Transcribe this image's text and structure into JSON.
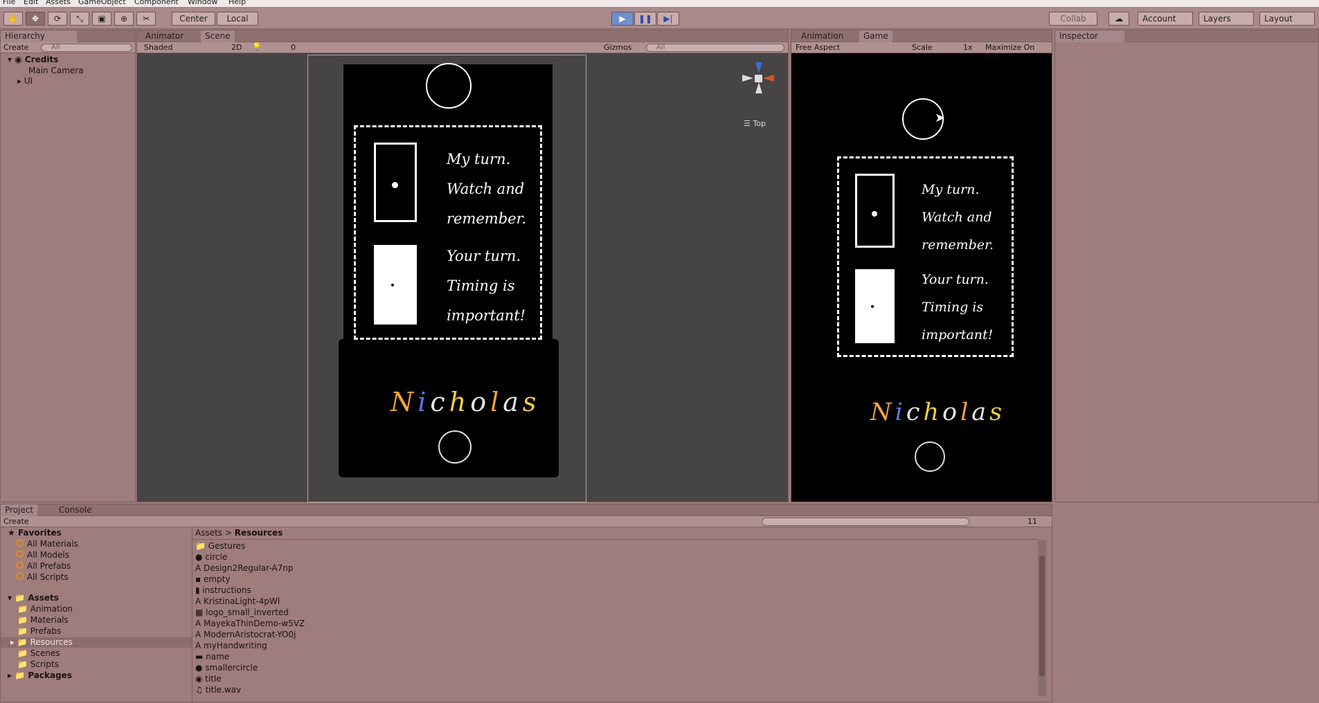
{
  "menu": [
    "File",
    "Edit",
    "Assets",
    "GameObject",
    "Component",
    "Window",
    "Help"
  ],
  "toolbar": {
    "center_label": "Center",
    "local_label": "Local",
    "collab_label": "Collab",
    "account_label": "Account",
    "layers_label": "Layers",
    "layout_label": "Layout"
  },
  "hierarchy": {
    "tab": "Hierarchy",
    "create": "Create",
    "search_placeholder": "All",
    "scene": "Credits",
    "items": [
      "Main Camera",
      "UI"
    ]
  },
  "scene_view": {
    "tabs": [
      "Animator",
      "Scene"
    ],
    "shading": "Shaded",
    "mode_2d": "2D",
    "fx_count": "0",
    "gizmos": "Gizmos",
    "search_placeholder": "All",
    "orientation": "Top"
  },
  "game_view": {
    "tabs": [
      "Animation",
      "Game"
    ],
    "aspect": "Free Aspect",
    "scale_label": "Scale",
    "scale_value": "1x",
    "maximize": "Maximize On Play"
  },
  "inspector": {
    "tab": "Inspector"
  },
  "credits_card": {
    "text1": [
      "My turn.",
      "Watch and",
      "remember."
    ],
    "text2": [
      "Your turn.",
      "Timing is",
      "important!"
    ],
    "name": "Nicholas",
    "name_colors": [
      "#f0a33c",
      "#5a78e8",
      "#e8e8e8",
      "#f0d040",
      "#e8e8e8",
      "#f0a33c",
      "#e8e8e8",
      "#f0d040"
    ]
  },
  "project": {
    "tabs": [
      "Project",
      "Console"
    ],
    "create": "Create",
    "favorites_label": "Favorites",
    "favorites": [
      "All Materials",
      "All Models",
      "All Prefabs",
      "All Scripts"
    ],
    "assets_label": "Assets",
    "asset_folders": [
      "Animation",
      "Materials",
      "Prefabs",
      "Resources",
      "Scenes",
      "Scripts"
    ],
    "packages_label": "Packages",
    "breadcrumb": [
      "Assets",
      "Resources"
    ],
    "hidden_count": "11",
    "files": [
      "Gestures",
      "circle",
      "Design2Regular-A7np",
      "empty",
      "instructions",
      "KristinaLight-4pWl",
      "logo_small_inverted",
      "MayekaThinDemo-w5VZ",
      "ModernAristocrat-YO0j",
      "myHandwriting",
      "name",
      "smallercircle",
      "title",
      "title.wav"
    ]
  }
}
